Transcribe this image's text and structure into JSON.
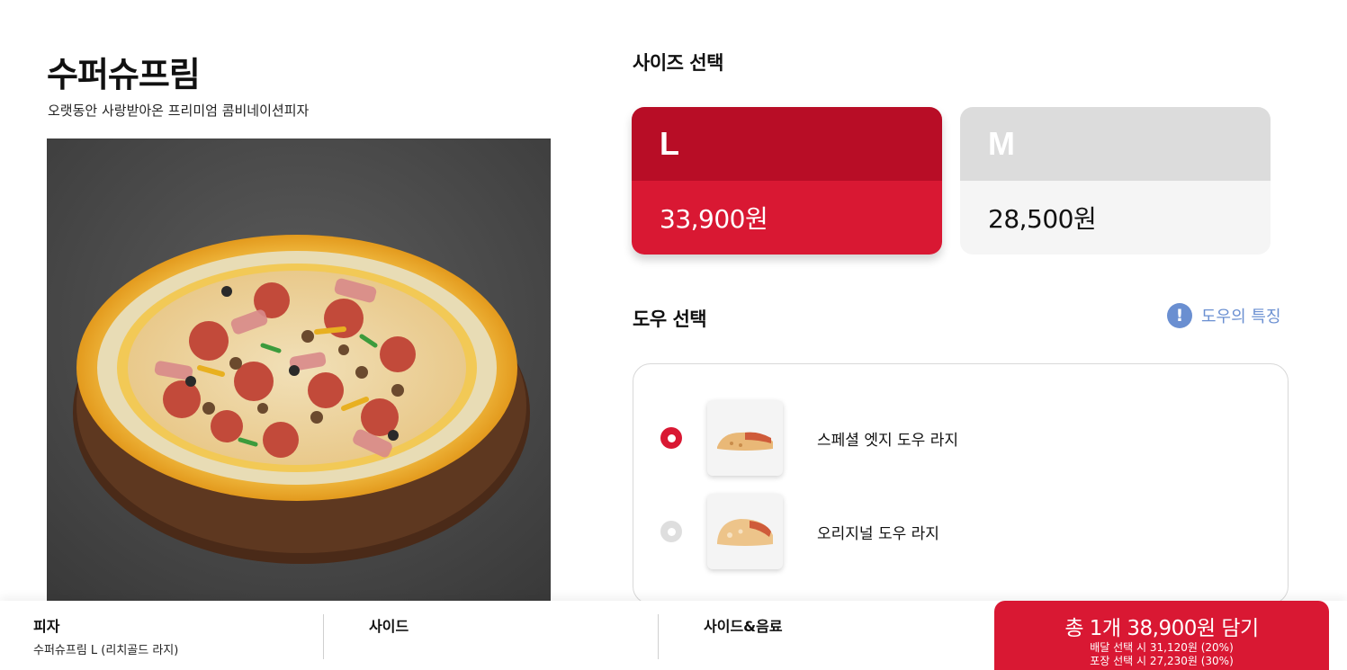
{
  "product": {
    "title": "수퍼슈프림",
    "description": "오랫동안 사랑받아온 프리미엄 콤비네이션피자",
    "image_icon": "pizza-image"
  },
  "size": {
    "title": "사이즈 선택",
    "options": [
      {
        "label": "L",
        "price": "33,900원",
        "selected": true
      },
      {
        "label": "M",
        "price": "28,500원",
        "selected": false
      }
    ]
  },
  "dough": {
    "title": "도우 선택",
    "info_label": "도우의 특징",
    "info_icon": "!",
    "options": [
      {
        "label": "스페셜 엣지 도우 라지",
        "selected": true
      },
      {
        "label": "오리지널 도우 라지",
        "selected": false
      }
    ]
  },
  "bottom_bar": {
    "tabs": [
      {
        "title": "피자",
        "subtitle": "수퍼슈프림 L (리치골드 라지)"
      },
      {
        "title": "사이드",
        "subtitle": ""
      },
      {
        "title": "사이드&음료",
        "subtitle": ""
      }
    ],
    "cart": {
      "main": "총 1개 38,900원 담기",
      "delivery": "배달 선택 시 31,120원 (20%)",
      "pickup": "포장 선택 시 27,230원 (30%)"
    }
  },
  "colors": {
    "brand_red": "#d91833",
    "brand_red_dark": "#b80d26",
    "info_blue": "#6a8fd1"
  }
}
